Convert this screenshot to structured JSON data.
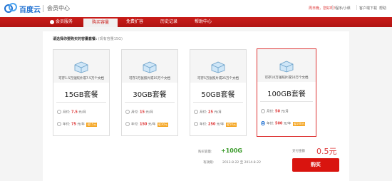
{
  "header": {
    "brand": "百度云",
    "subtitle": "会员中心",
    "hello": "周日晚，您好啊！",
    "links": [
      "程序/小课",
      "客户端下载",
      "帮助"
    ]
  },
  "nav": {
    "items": [
      {
        "label": "会员服务",
        "active": false
      },
      {
        "label": "购买容量",
        "active": true
      },
      {
        "label": "免费扩容",
        "active": false
      },
      {
        "label": "历史记录",
        "active": false
      },
      {
        "label": "帮助中心",
        "active": false
      }
    ]
  },
  "main": {
    "prompt": "请选择你要购买的容量套餐:",
    "prompt_note": "(现有容量15G)"
  },
  "packages": [
    {
      "desc": "可存1.5万张照片或7.5万个文档",
      "size": "15GB套餐",
      "month_label": "月付:",
      "month_price": "7.5",
      "month_unit": "元/月",
      "year_label": "年付:",
      "year_price": "75",
      "year_unit": "元/年",
      "year_badge": "省15元",
      "selected": false
    },
    {
      "desc": "可存3万张照片或15万个文档",
      "size": "30GB套餐",
      "month_label": "月付:",
      "month_price": "15",
      "month_unit": "元/月",
      "year_label": "年付:",
      "year_price": "150",
      "year_unit": "元/年",
      "year_badge": "省30元",
      "selected": false
    },
    {
      "desc": "可存5万张照片或25万个文档",
      "size": "50GB套餐",
      "month_label": "月付:",
      "month_price": "25",
      "month_unit": "元/月",
      "year_label": "年付:",
      "year_price": "250",
      "year_unit": "元/年",
      "year_badge": "省50元",
      "selected": false
    },
    {
      "desc": "可存10万张照片或50万个文档",
      "size": "100GB套餐",
      "month_label": "月付:",
      "month_price": "50",
      "month_unit": "元/月",
      "year_label": "年付:",
      "year_price": "500",
      "year_unit": "元/年",
      "year_badge": "省100元",
      "selected": true
    }
  ],
  "summary": {
    "capacity_label": "购买容量:",
    "capacity_value": "+100G",
    "period_label": "有效期:",
    "period_value": "2013-8-22 至 2014-8-22",
    "total_label": "支付金额",
    "total_value": "0.5元",
    "buy_label": "购买"
  },
  "colors": {
    "accent": "#c91c19",
    "blue": "#1d6fd1",
    "green": "#3a9a2a"
  }
}
